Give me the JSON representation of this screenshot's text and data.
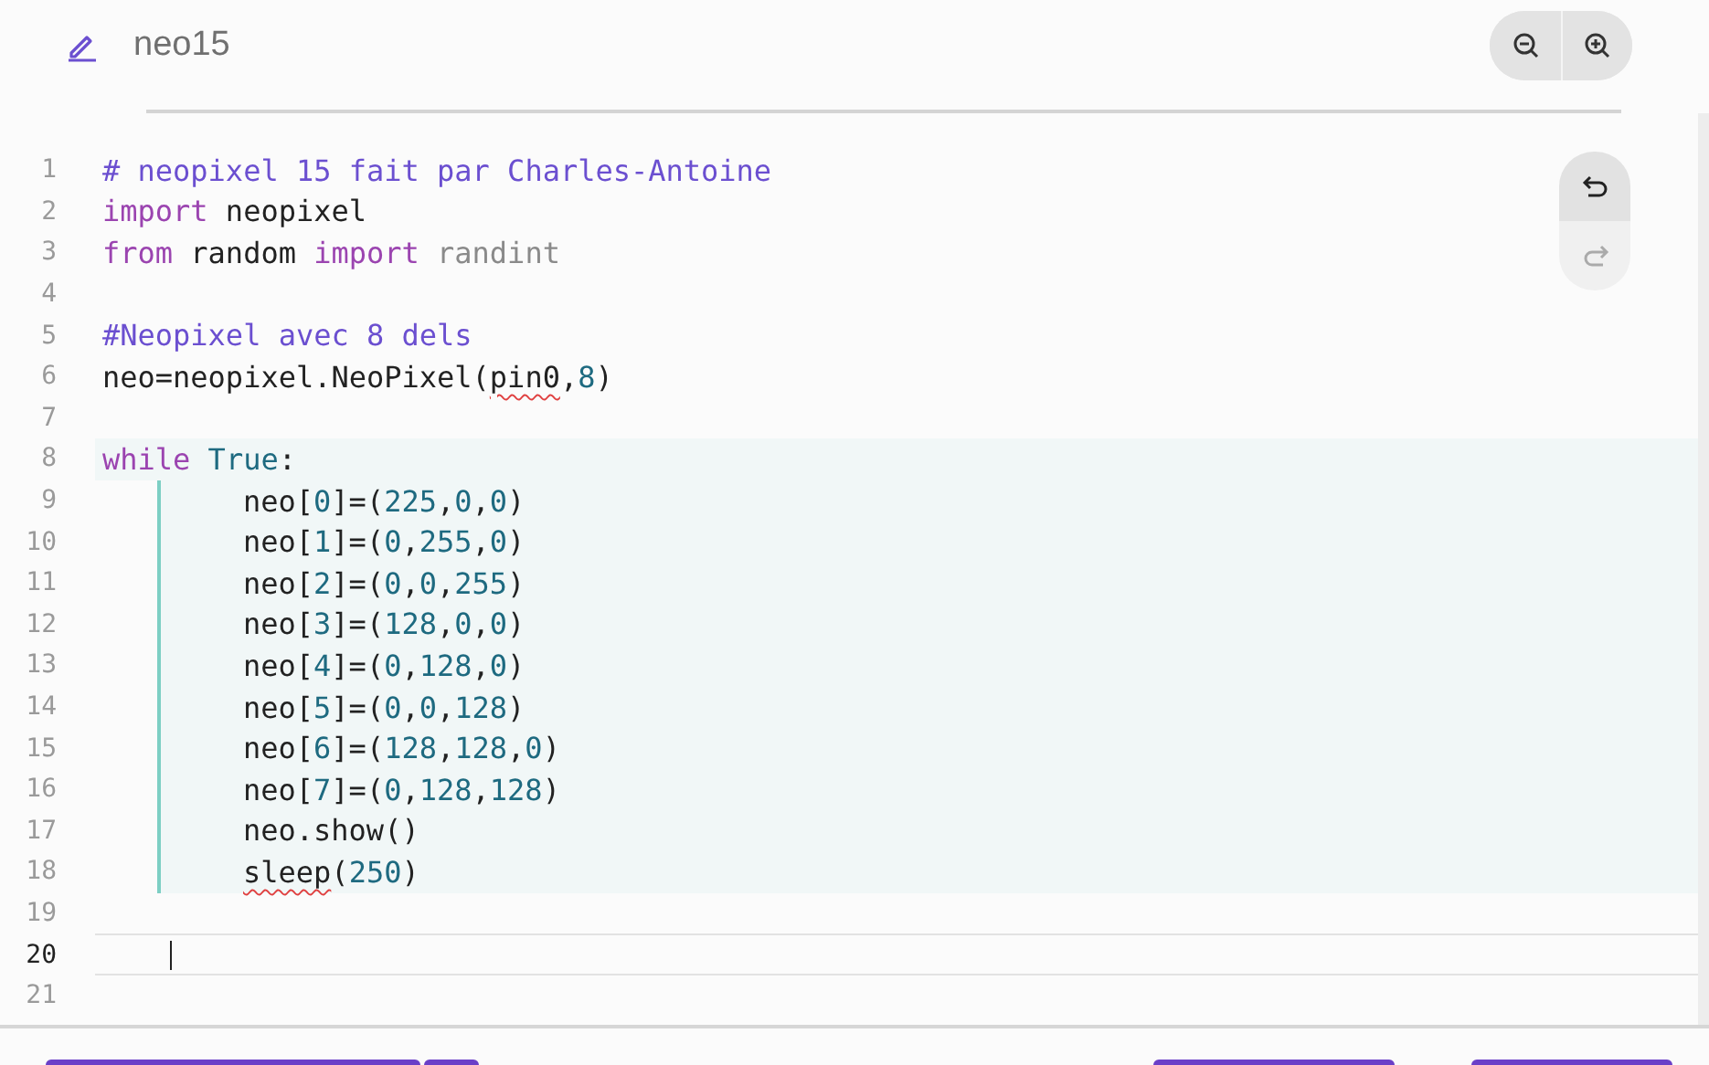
{
  "file": {
    "name": "neo15"
  },
  "zoom_buttons": [
    {
      "kind": "zoom-out"
    },
    {
      "kind": "zoom-in"
    }
  ],
  "history_buttons": [
    {
      "kind": "undo",
      "disabled": false
    },
    {
      "kind": "redo",
      "disabled": true
    }
  ],
  "lines": [
    {
      "number": "1",
      "current": false,
      "tokens": [
        {
          "kind": "comment",
          "text": "# neopixel 15 fait par Charles-Antoine"
        }
      ]
    },
    {
      "number": "2",
      "current": false,
      "tokens": [
        {
          "kind": "keyword",
          "text": "import"
        },
        {
          "kind": "plain",
          "text": " neopixel"
        }
      ]
    },
    {
      "number": "3",
      "current": false,
      "tokens": [
        {
          "kind": "keyword",
          "text": "from"
        },
        {
          "kind": "plain",
          "text": " random "
        },
        {
          "kind": "keyword",
          "text": "import"
        },
        {
          "kind": "dim",
          "text": " randint"
        }
      ]
    },
    {
      "number": "4",
      "current": false
    },
    {
      "number": "5",
      "current": false,
      "tokens": [
        {
          "kind": "comment",
          "text": "#Neopixel avec 8 dels"
        }
      ]
    },
    {
      "number": "6",
      "current": false,
      "tokens": [
        {
          "kind": "plain",
          "text": "neo=neopixel.NeoPixel("
        },
        {
          "kind": "error",
          "text": "pin0"
        },
        {
          "kind": "plain",
          "text": ","
        },
        {
          "kind": "number",
          "text": "8"
        },
        {
          "kind": "plain",
          "text": ")"
        }
      ]
    },
    {
      "number": "7",
      "current": false
    },
    {
      "number": "8",
      "current": false,
      "tokens": [
        {
          "kind": "keyword",
          "text": "while"
        },
        {
          "kind": "number",
          "text": " True"
        },
        {
          "kind": "plain",
          "text": ":"
        }
      ],
      "children": [
        {
          "number": "9",
          "current": false,
          "tokens": [
            {
              "kind": "plain",
              "text": "neo["
            },
            {
              "kind": "number",
              "text": "0"
            },
            {
              "kind": "plain",
              "text": "]=("
            },
            {
              "kind": "number",
              "text": "225"
            },
            {
              "kind": "plain",
              "text": ","
            },
            {
              "kind": "number",
              "text": "0"
            },
            {
              "kind": "plain",
              "text": ","
            },
            {
              "kind": "number",
              "text": "0"
            },
            {
              "kind": "plain",
              "text": ")"
            }
          ]
        },
        {
          "number": "10",
          "current": false,
          "tokens": [
            {
              "kind": "plain",
              "text": "neo["
            },
            {
              "kind": "number",
              "text": "1"
            },
            {
              "kind": "plain",
              "text": "]=("
            },
            {
              "kind": "number",
              "text": "0"
            },
            {
              "kind": "plain",
              "text": ","
            },
            {
              "kind": "number",
              "text": "255"
            },
            {
              "kind": "plain",
              "text": ","
            },
            {
              "kind": "number",
              "text": "0"
            },
            {
              "kind": "plain",
              "text": ")"
            }
          ]
        },
        {
          "number": "11",
          "current": false,
          "tokens": [
            {
              "kind": "plain",
              "text": "neo["
            },
            {
              "kind": "number",
              "text": "2"
            },
            {
              "kind": "plain",
              "text": "]=("
            },
            {
              "kind": "number",
              "text": "0"
            },
            {
              "kind": "plain",
              "text": ","
            },
            {
              "kind": "number",
              "text": "0"
            },
            {
              "kind": "plain",
              "text": ","
            },
            {
              "kind": "number",
              "text": "255"
            },
            {
              "kind": "plain",
              "text": ")"
            }
          ]
        },
        {
          "number": "12",
          "current": false,
          "tokens": [
            {
              "kind": "plain",
              "text": "neo["
            },
            {
              "kind": "number",
              "text": "3"
            },
            {
              "kind": "plain",
              "text": "]=("
            },
            {
              "kind": "number",
              "text": "128"
            },
            {
              "kind": "plain",
              "text": ","
            },
            {
              "kind": "number",
              "text": "0"
            },
            {
              "kind": "plain",
              "text": ","
            },
            {
              "kind": "number",
              "text": "0"
            },
            {
              "kind": "plain",
              "text": ")"
            }
          ]
        },
        {
          "number": "13",
          "current": false,
          "tokens": [
            {
              "kind": "plain",
              "text": "neo["
            },
            {
              "kind": "number",
              "text": "4"
            },
            {
              "kind": "plain",
              "text": "]=("
            },
            {
              "kind": "number",
              "text": "0"
            },
            {
              "kind": "plain",
              "text": ","
            },
            {
              "kind": "number",
              "text": "128"
            },
            {
              "kind": "plain",
              "text": ","
            },
            {
              "kind": "number",
              "text": "0"
            },
            {
              "kind": "plain",
              "text": ")"
            }
          ]
        },
        {
          "number": "14",
          "current": false,
          "tokens": [
            {
              "kind": "plain",
              "text": "neo["
            },
            {
              "kind": "number",
              "text": "5"
            },
            {
              "kind": "plain",
              "text": "]=("
            },
            {
              "kind": "number",
              "text": "0"
            },
            {
              "kind": "plain",
              "text": ","
            },
            {
              "kind": "number",
              "text": "0"
            },
            {
              "kind": "plain",
              "text": ","
            },
            {
              "kind": "number",
              "text": "128"
            },
            {
              "kind": "plain",
              "text": ")"
            }
          ]
        },
        {
          "number": "15",
          "current": false,
          "tokens": [
            {
              "kind": "plain",
              "text": "neo["
            },
            {
              "kind": "number",
              "text": "6"
            },
            {
              "kind": "plain",
              "text": "]=("
            },
            {
              "kind": "number",
              "text": "128"
            },
            {
              "kind": "plain",
              "text": ","
            },
            {
              "kind": "number",
              "text": "128"
            },
            {
              "kind": "plain",
              "text": ","
            },
            {
              "kind": "number",
              "text": "0"
            },
            {
              "kind": "plain",
              "text": ")"
            }
          ]
        },
        {
          "number": "16",
          "current": false,
          "tokens": [
            {
              "kind": "plain",
              "text": "neo["
            },
            {
              "kind": "number",
              "text": "7"
            },
            {
              "kind": "plain",
              "text": "]=("
            },
            {
              "kind": "number",
              "text": "0"
            },
            {
              "kind": "plain",
              "text": ","
            },
            {
              "kind": "number",
              "text": "128"
            },
            {
              "kind": "plain",
              "text": ","
            },
            {
              "kind": "number",
              "text": "128"
            },
            {
              "kind": "plain",
              "text": ")"
            }
          ]
        },
        {
          "number": "17",
          "current": false,
          "tokens": [
            {
              "kind": "plain",
              "text": "neo.show()"
            }
          ]
        },
        {
          "number": "18",
          "current": false,
          "tokens": [
            {
              "kind": "error",
              "text": "sleep"
            },
            {
              "kind": "plain",
              "text": "("
            },
            {
              "kind": "number",
              "text": "250"
            },
            {
              "kind": "plain",
              "text": ")"
            }
          ]
        }
      ]
    },
    {
      "number": "19",
      "current": false
    },
    {
      "number": "20",
      "current": true
    },
    {
      "number": "21",
      "current": false
    }
  ]
}
